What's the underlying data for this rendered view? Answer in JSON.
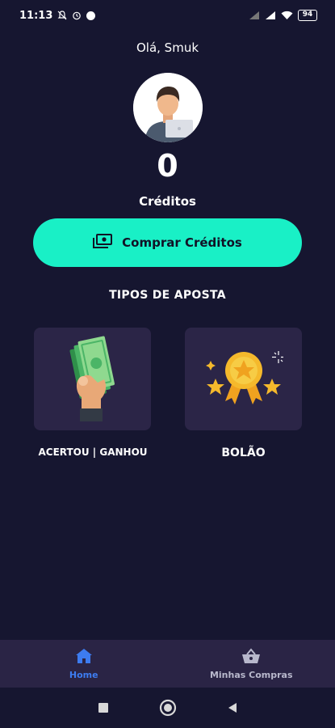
{
  "status_bar": {
    "time": "11:13",
    "battery": "94",
    "icons": [
      "notifications-off-icon",
      "alarm-icon",
      "dot-icon",
      "signal-icon",
      "signal-icon",
      "wifi-icon",
      "battery-icon"
    ]
  },
  "profile": {
    "greeting": "Olá, Smuk",
    "avatar_icon": "user-avatar-icon",
    "credits_value": "0",
    "credits_label": "Créditos"
  },
  "buy_button": {
    "label": "Comprar Créditos",
    "icon": "money-icon"
  },
  "bet_types": {
    "title": "TIPOS DE APOSTA",
    "items": [
      {
        "label": "ACERTOU | GANHOU",
        "icon": "cash-hand-icon"
      },
      {
        "label": "BOLÃO",
        "icon": "medal-stars-icon"
      }
    ]
  },
  "bottom_nav": {
    "items": [
      {
        "label": "Home",
        "icon": "home-icon",
        "active": true
      },
      {
        "label": "Minhas Compras",
        "icon": "basket-icon",
        "active": false
      }
    ]
  },
  "colors": {
    "background": "#161630",
    "accent": "#19f0c6",
    "card": "#2b2547",
    "nav_active": "#3d7cf0",
    "nav_bar": "#2a2445"
  }
}
